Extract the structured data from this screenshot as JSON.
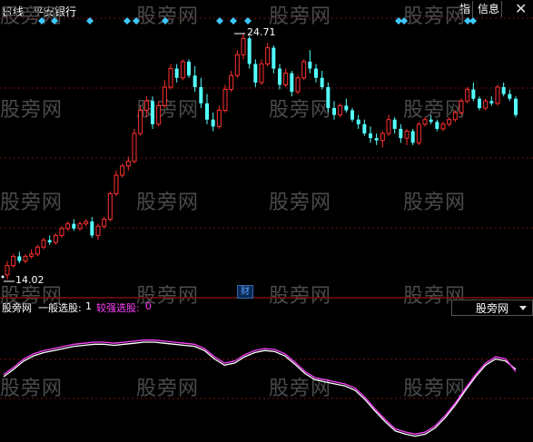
{
  "header": {
    "period": "日线",
    "stock_name": "平安银行",
    "btn_index": "指",
    "btn_info": "信息",
    "close_glyph": "✕"
  },
  "watermark_text": "股旁网",
  "main_chart": {
    "high_label": "24.71",
    "low_label": "14.02",
    "finance_marker": "财",
    "colors": {
      "up": "#ff3030",
      "down": "#54ffff",
      "signal": "#3ec8ff",
      "grid": "#7a1010"
    }
  },
  "indicator": {
    "name": "股旁网",
    "line1_label": "一般选股:",
    "line1_value": "1",
    "line2_label": "较强选股:",
    "line2_value": "0",
    "dropdown_value": "股旁网",
    "colors": {
      "line1": "#ffffff",
      "line2": "#ff40ff"
    }
  },
  "chart_data": [
    {
      "type": "candlestick",
      "title": "平安银行",
      "annotations": [
        "24.71",
        "14.02"
      ],
      "series": [
        {
          "values": [
            [
              14.3,
              14.9,
              14.1,
              14.7
            ],
            [
              14.7,
              15.2,
              14.6,
              15.1
            ],
            [
              15.1,
              15.3,
              14.8,
              14.9
            ],
            [
              14.9,
              15.2,
              14.8,
              15.1
            ],
            [
              15.1,
              15.4,
              15.0,
              15.2
            ],
            [
              15.2,
              15.6,
              15.1,
              15.5
            ],
            [
              15.5,
              15.9,
              15.4,
              15.8
            ],
            [
              15.8,
              16.0,
              15.6,
              15.7
            ],
            [
              15.7,
              16.1,
              15.6,
              16.0
            ],
            [
              16.0,
              16.4,
              15.9,
              16.3
            ],
            [
              16.3,
              16.6,
              16.2,
              16.5
            ],
            [
              16.5,
              16.7,
              16.2,
              16.3
            ],
            [
              16.3,
              16.6,
              16.2,
              16.5
            ],
            [
              16.5,
              16.7,
              16.4,
              16.6
            ],
            [
              16.6,
              16.8,
              15.9,
              16.0
            ],
            [
              16.0,
              16.5,
              15.8,
              16.4
            ],
            [
              16.4,
              16.8,
              16.3,
              16.7
            ],
            [
              16.7,
              17.9,
              16.6,
              17.8
            ],
            [
              17.8,
              18.8,
              17.7,
              18.6
            ],
            [
              18.6,
              19.1,
              18.5,
              19.0
            ],
            [
              19.0,
              19.4,
              18.8,
              19.2
            ],
            [
              19.2,
              20.6,
              19.1,
              20.4
            ],
            [
              20.4,
              21.6,
              20.3,
              21.4
            ],
            [
              21.4,
              22.0,
              21.1,
              21.8
            ],
            [
              21.8,
              22.0,
              20.6,
              20.8
            ],
            [
              20.8,
              21.8,
              20.7,
              21.6
            ],
            [
              21.6,
              22.7,
              21.5,
              22.4
            ],
            [
              22.4,
              23.4,
              22.3,
              23.2
            ],
            [
              23.2,
              23.4,
              22.6,
              22.8
            ],
            [
              22.8,
              23.6,
              22.7,
              23.5
            ],
            [
              23.5,
              23.6,
              22.8,
              22.9
            ],
            [
              22.9,
              23.3,
              22.2,
              22.4
            ],
            [
              22.4,
              22.8,
              21.5,
              21.7
            ],
            [
              21.7,
              22.1,
              20.8,
              21.0
            ],
            [
              21.0,
              21.3,
              20.5,
              20.7
            ],
            [
              20.7,
              21.6,
              20.6,
              21.4
            ],
            [
              21.4,
              22.5,
              21.3,
              22.3
            ],
            [
              22.3,
              23.1,
              22.2,
              22.9
            ],
            [
              22.9,
              24.0,
              22.8,
              23.8
            ],
            [
              23.8,
              24.71,
              23.6,
              24.5
            ],
            [
              24.5,
              24.6,
              23.2,
              23.4
            ],
            [
              23.4,
              23.6,
              22.4,
              22.6
            ],
            [
              22.6,
              23.6,
              22.5,
              23.4
            ],
            [
              23.4,
              24.3,
              23.3,
              24.1
            ],
            [
              24.1,
              24.2,
              23.0,
              23.2
            ],
            [
              23.2,
              23.4,
              22.3,
              22.5
            ],
            [
              22.5,
              23.2,
              22.4,
              23.0
            ],
            [
              23.0,
              23.1,
              22.0,
              22.2
            ],
            [
              22.2,
              22.9,
              22.1,
              22.8
            ],
            [
              22.8,
              23.6,
              22.7,
              23.5
            ],
            [
              23.5,
              24.0,
              23.0,
              23.2
            ],
            [
              23.2,
              23.4,
              22.6,
              22.8
            ],
            [
              22.8,
              23.1,
              22.3,
              22.4
            ],
            [
              22.4,
              22.6,
              21.3,
              21.5
            ],
            [
              21.5,
              21.8,
              21.0,
              21.2
            ],
            [
              21.2,
              21.7,
              21.1,
              21.6
            ],
            [
              21.6,
              21.9,
              21.3,
              21.4
            ],
            [
              21.4,
              21.5,
              20.9,
              21.0
            ],
            [
              21.0,
              21.2,
              20.6,
              20.8
            ],
            [
              20.8,
              21.0,
              20.3,
              20.4
            ],
            [
              20.4,
              20.7,
              20.0,
              20.2
            ],
            [
              20.2,
              20.4,
              19.9,
              20.1
            ],
            [
              20.1,
              20.5,
              19.8,
              20.4
            ],
            [
              20.4,
              21.2,
              20.3,
              21.0
            ],
            [
              21.0,
              21.1,
              20.4,
              20.6
            ],
            [
              20.6,
              20.8,
              20.0,
              20.2
            ],
            [
              20.2,
              20.6,
              19.9,
              20.5
            ],
            [
              20.5,
              20.6,
              19.9,
              20.0
            ],
            [
              20.0,
              20.9,
              19.9,
              20.8
            ],
            [
              20.8,
              21.1,
              20.7,
              21.0
            ],
            [
              21.0,
              21.2,
              20.8,
              20.9
            ],
            [
              20.9,
              21.0,
              20.5,
              20.6
            ],
            [
              20.6,
              20.9,
              20.5,
              20.8
            ],
            [
              20.8,
              21.1,
              20.7,
              21.0
            ],
            [
              21.0,
              21.4,
              20.9,
              21.3
            ],
            [
              21.3,
              21.9,
              21.2,
              21.8
            ],
            [
              21.8,
              22.4,
              21.7,
              22.3
            ],
            [
              22.3,
              22.6,
              21.8,
              21.9
            ],
            [
              21.9,
              22.0,
              21.4,
              21.5
            ],
            [
              21.5,
              21.9,
              21.4,
              21.8
            ],
            [
              21.8,
              22.0,
              21.6,
              21.7
            ],
            [
              21.7,
              22.5,
              21.6,
              22.4
            ],
            [
              22.4,
              22.6,
              22.0,
              22.1
            ],
            [
              22.1,
              22.3,
              21.8,
              21.9
            ],
            [
              21.9,
              22.0,
              21.1,
              21.2
            ]
          ]
        }
      ]
    },
    {
      "type": "line",
      "series": [
        {
          "name": "一般选股",
          "values": [
            0.55,
            0.62,
            0.7,
            0.75,
            0.78,
            0.8,
            0.82,
            0.84,
            0.85,
            0.86,
            0.86,
            0.85,
            0.86,
            0.87,
            0.88,
            0.88,
            0.87,
            0.86,
            0.85,
            0.84,
            0.8,
            0.72,
            0.66,
            0.68,
            0.74,
            0.78,
            0.8,
            0.79,
            0.75,
            0.67,
            0.58,
            0.52,
            0.5,
            0.48,
            0.46,
            0.42,
            0.33,
            0.22,
            0.12,
            0.03,
            0.0,
            -0.02,
            0.0,
            0.06,
            0.16,
            0.28,
            0.42,
            0.55,
            0.66,
            0.72,
            0.7,
            0.62
          ]
        },
        {
          "name": "较强选股",
          "values": [
            0.57,
            0.64,
            0.72,
            0.77,
            0.8,
            0.82,
            0.84,
            0.86,
            0.87,
            0.88,
            0.88,
            0.87,
            0.88,
            0.89,
            0.9,
            0.9,
            0.89,
            0.88,
            0.87,
            0.86,
            0.82,
            0.74,
            0.68,
            0.7,
            0.76,
            0.8,
            0.82,
            0.81,
            0.77,
            0.69,
            0.6,
            0.54,
            0.52,
            0.5,
            0.48,
            0.44,
            0.35,
            0.24,
            0.14,
            0.05,
            0.02,
            0.0,
            0.02,
            0.08,
            0.18,
            0.3,
            0.44,
            0.57,
            0.68,
            0.74,
            0.72,
            0.6
          ]
        }
      ]
    }
  ]
}
